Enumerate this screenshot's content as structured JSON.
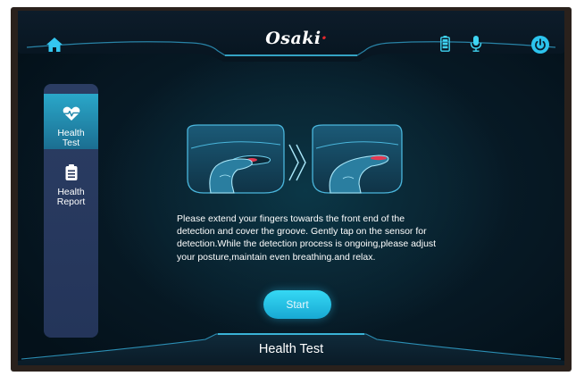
{
  "header": {
    "brand": "Osaki",
    "brand_accent": "#e3282d",
    "icons": [
      "home-icon",
      "battery-icon",
      "microphone-icon",
      "power-icon"
    ],
    "accent": "#2cc4ee"
  },
  "sidebar": {
    "items": [
      {
        "label_line1": "Health",
        "label_line2": "Test",
        "icon": "heart-pulse-icon",
        "active": true
      },
      {
        "label_line1": "Health",
        "label_line2": "Report",
        "icon": "clipboard-icon",
        "active": false
      }
    ]
  },
  "main": {
    "illustration": [
      "finger-in-groove-icon",
      "double-chevron-right-icon",
      "finger-on-sensor-icon"
    ],
    "instructions": "Please extend your fingers towards the front end of the detection and cover the groove. Gently tap on the sensor for detection.While the detection process is ongoing,please adjust your posture,maintain even breathing.and relax.",
    "start_label": "Start"
  },
  "footer": {
    "title": "Health Test"
  }
}
